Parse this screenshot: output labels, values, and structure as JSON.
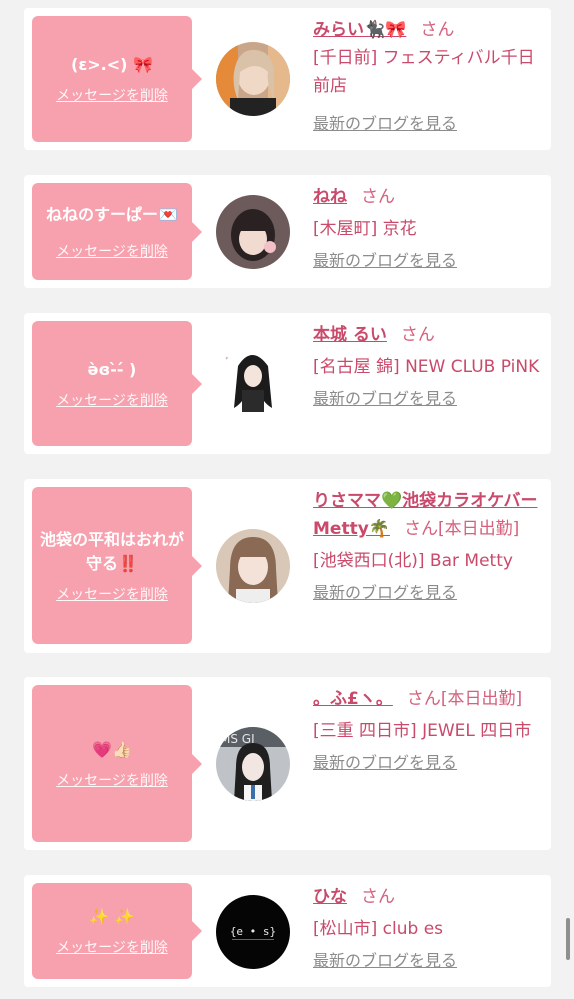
{
  "delete_label": "メッセージを削除",
  "blog_label": "最新のブログを見る",
  "colors": {
    "bubble": "#f8a1ae",
    "name": "#c94a6b",
    "link_gray": "#8c8c8c",
    "background": "#f2f2f2"
  },
  "cards": [
    {
      "message": "(ε>.<) 🎀",
      "name": "みらい🐈‍⬛🎀",
      "suffix": "さん",
      "location": "[千日前] フェスティバル千日前店"
    },
    {
      "message": "ねねのすーぱー💌",
      "name": "ねね",
      "suffix": "さん",
      "location": "[木屋町] 京花"
    },
    {
      "message": "ə̀ɞ-̀-́ )",
      "name": "本城 るい",
      "suffix": "さん",
      "location": "[名古屋 錦] NEW CLUB PiNK"
    },
    {
      "message": "池袋の平和はおれが守る‼️",
      "name": "りさママ💚池袋カラオケバーMetty🌴",
      "suffix": "さん[本日出勤]",
      "location": "[池袋西口(北)] Bar Metty"
    },
    {
      "message": "💗👍🏻",
      "name": "。ふ£ヽ。",
      "suffix": "さん[本日出勤]",
      "location": "[三重 四日市] JEWEL 四日市"
    },
    {
      "message": "✨ ✨",
      "name": "ひな",
      "suffix": "さん",
      "location": "[松山市] club es"
    }
  ],
  "avatar_texts": {
    "hina_logo": "{e • s}"
  }
}
